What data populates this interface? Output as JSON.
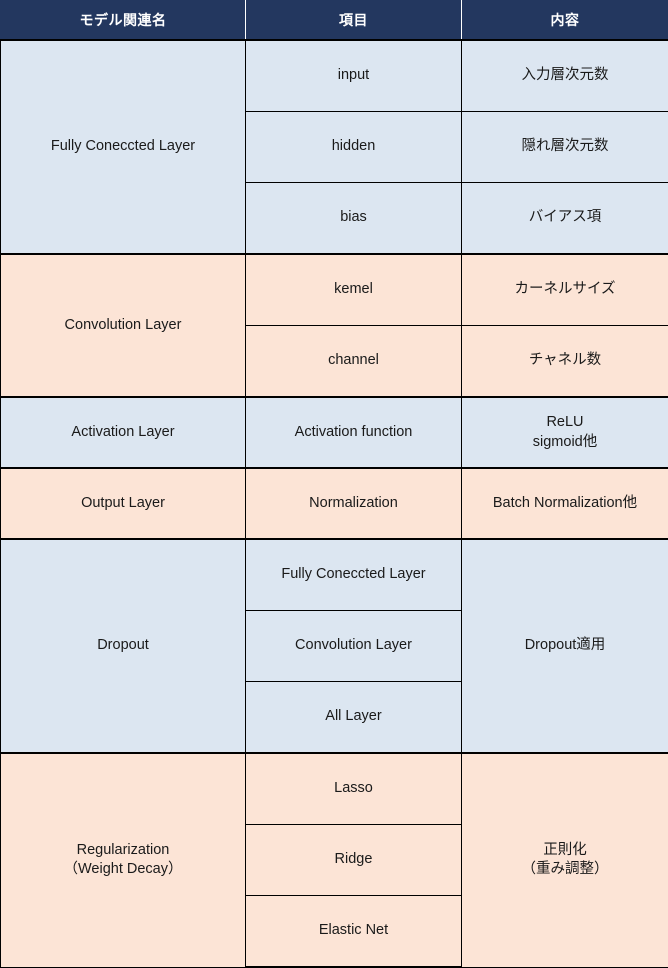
{
  "table": {
    "headers": {
      "col1": "モデル関連名",
      "col2": "項目",
      "col3": "内容"
    },
    "colors": {
      "header_bg": "#23375f",
      "header_fg": "#ffffff",
      "band_blue": "#dce6f1",
      "band_peach": "#fce4d6",
      "border": "#000000"
    },
    "sections": [
      {
        "name": "Fully Coneccted Layer",
        "tint": "blue",
        "rows": [
          {
            "item": "input",
            "detail": "入力層次元数"
          },
          {
            "item": "hidden",
            "detail": "隠れ層次元数"
          },
          {
            "item": "bias",
            "detail": "バイアス項"
          }
        ]
      },
      {
        "name": "Convolution Layer",
        "tint": "peach",
        "rows": [
          {
            "item": "kemel",
            "detail": "カーネルサイズ"
          },
          {
            "item": "channel",
            "detail": "チャネル数"
          }
        ]
      },
      {
        "name": "Activation Layer",
        "tint": "blue",
        "rows": [
          {
            "item": "Activation function",
            "detail": "ReLU\nsigmoid他"
          }
        ]
      },
      {
        "name": "Output Layer",
        "tint": "peach",
        "rows": [
          {
            "item": "Normalization",
            "detail": "Batch Normalization他"
          }
        ]
      },
      {
        "name": "Dropout",
        "tint": "blue",
        "detail_merged": "Dropout適用",
        "rows": [
          {
            "item": "Fully Coneccted Layer"
          },
          {
            "item": "Convolution Layer"
          },
          {
            "item": "All Layer"
          }
        ]
      },
      {
        "name": "Regularization\n（Weight Decay）",
        "tint": "peach",
        "detail_merged": "正則化\n（重み調整）",
        "rows": [
          {
            "item": "Lasso"
          },
          {
            "item": "Ridge"
          },
          {
            "item": "Elastic Net"
          }
        ]
      }
    ]
  }
}
